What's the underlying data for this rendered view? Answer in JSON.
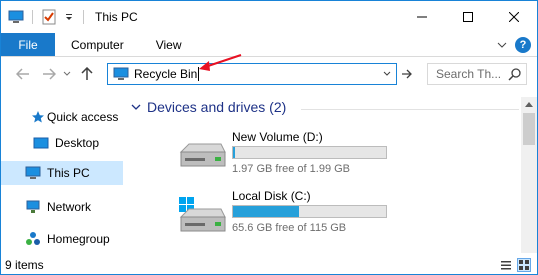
{
  "window": {
    "title": "This PC",
    "controls": [
      "minimize",
      "maximize",
      "close"
    ]
  },
  "ribbon": {
    "tabs": [
      {
        "label": "File",
        "active": true
      },
      {
        "label": "Computer"
      },
      {
        "label": "View"
      }
    ],
    "help_label": "?"
  },
  "address_bar": {
    "value": "Recycle Bin",
    "icon": "pc-icon"
  },
  "search": {
    "placeholder": "Search Th..."
  },
  "nav": {
    "items": [
      {
        "label": "Quick access",
        "icon": "star-icon"
      },
      {
        "label": "Desktop",
        "icon": "desktop-icon"
      },
      {
        "label": "This PC",
        "icon": "pc-icon",
        "selected": true
      },
      {
        "label": "Network",
        "icon": "network-icon"
      },
      {
        "label": "Homegroup",
        "icon": "homegroup-icon"
      }
    ]
  },
  "content": {
    "group_title": "Devices and drives (2)",
    "drives": [
      {
        "name": "New Volume (D:)",
        "free_text": "1.97 GB free of 1.99 GB",
        "used_fraction": 0.01,
        "icon": "hdd-icon"
      },
      {
        "name": "Local Disk (C:)",
        "free_text": "65.6 GB free of 115 GB",
        "used_fraction": 0.43,
        "icon": "windows-hdd-icon"
      }
    ]
  },
  "status": {
    "items_text": "9 items"
  },
  "colors": {
    "accent": "#1979ca",
    "group_title": "#1e3287",
    "selected": "#cce8ff",
    "bar_fill": "#26a0da",
    "annotation": "#e81123"
  }
}
